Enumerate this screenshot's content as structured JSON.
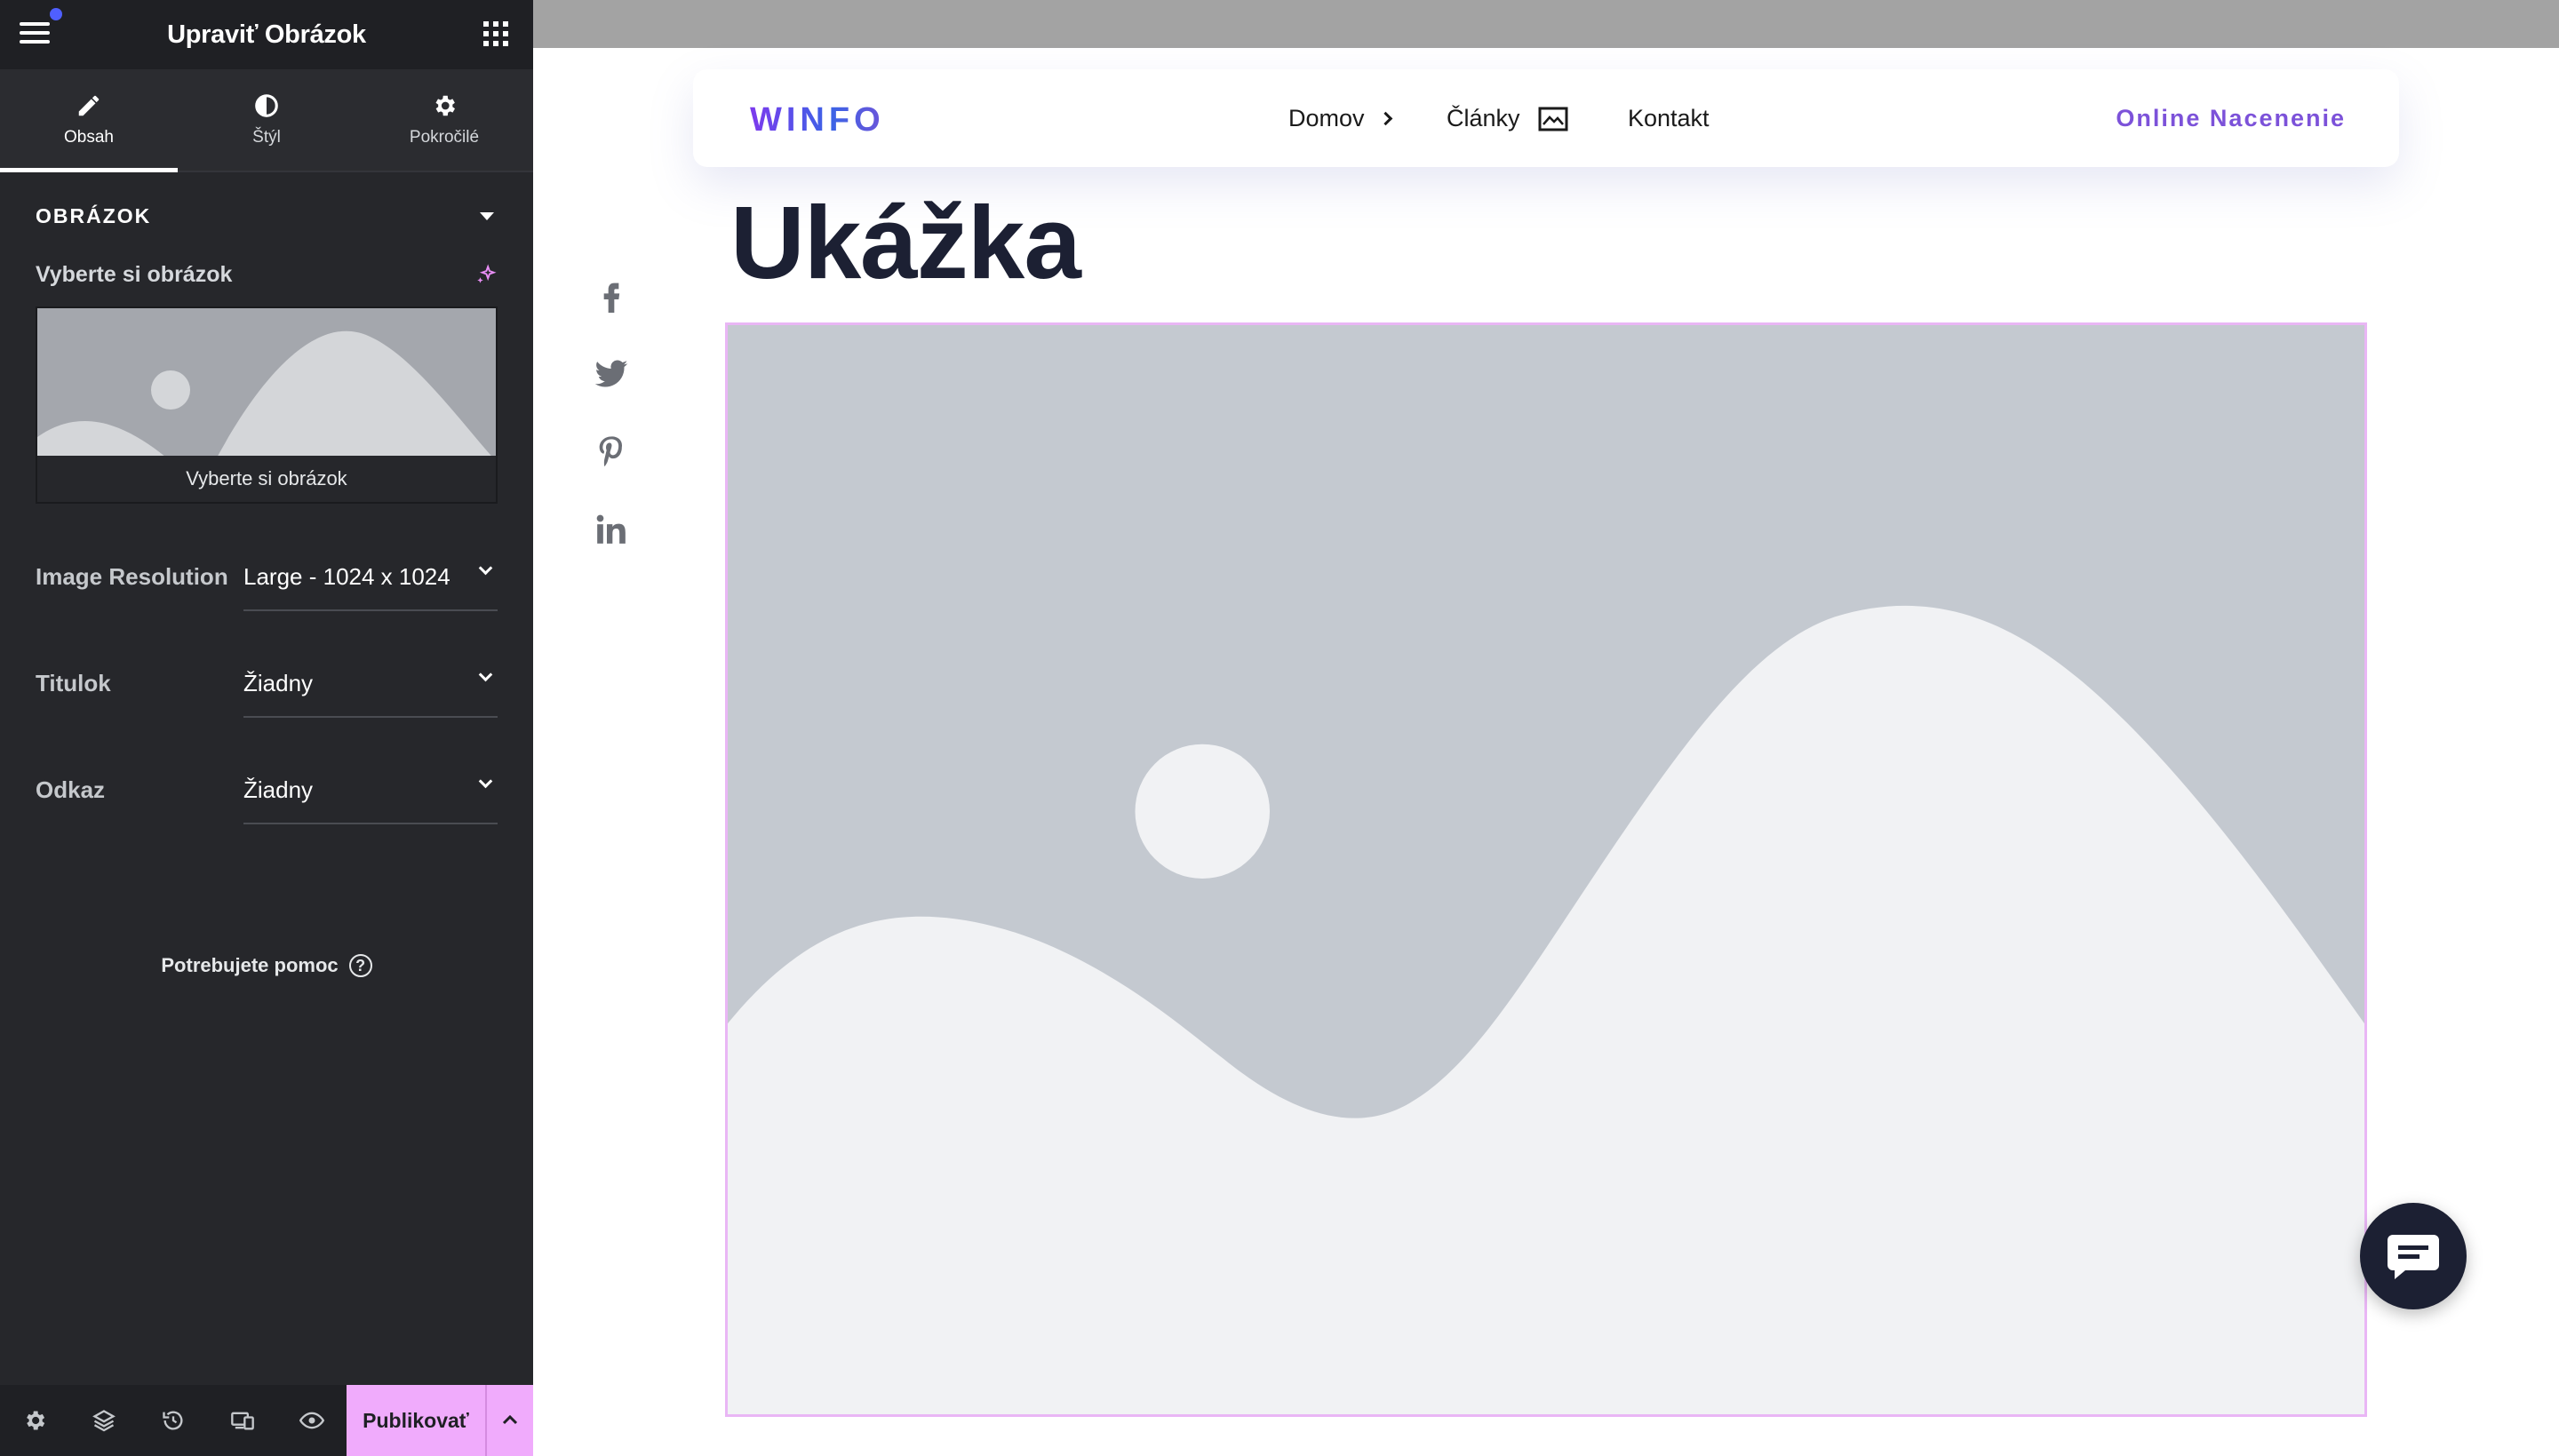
{
  "editor": {
    "title": "Upraviť Obrázok",
    "tabs": [
      {
        "label": "Obsah",
        "icon": "pencil-icon"
      },
      {
        "label": "Štýl",
        "icon": "half-circle-icon"
      },
      {
        "label": "Pokročilé",
        "icon": "gear-icon"
      }
    ],
    "section_title": "OBRÁZOK",
    "choose_image_label": "Vyberte si obrázok",
    "picker_button_label": "Vyberte si obrázok",
    "controls": [
      {
        "label": "Image Resolution",
        "value": "Large - 1024 x 1024"
      },
      {
        "label": "Titulok",
        "value": "Žiadny"
      },
      {
        "label": "Odkaz",
        "value": "Žiadny"
      }
    ],
    "help_label": "Potrebujete pomoc",
    "help_icon": "?",
    "publish_label": "Publikovať",
    "bottom_icons": [
      "settings-icon",
      "layers-icon",
      "history-icon",
      "responsive-icon",
      "preview-eye-icon"
    ],
    "notification_color": "#4f5fff"
  },
  "site": {
    "logo": "WINFO",
    "nav": [
      {
        "label": "Domov"
      },
      {
        "label": "Články"
      },
      {
        "label": "Kontakt"
      }
    ],
    "cta": "Online Nacenenie",
    "heading": "Ukážka",
    "social": [
      "facebook-icon",
      "twitter-icon",
      "pinterest-icon",
      "linkedin-icon"
    ],
    "accent_color": "#7c52d9",
    "selection_outline_color": "#e9b6f5"
  }
}
